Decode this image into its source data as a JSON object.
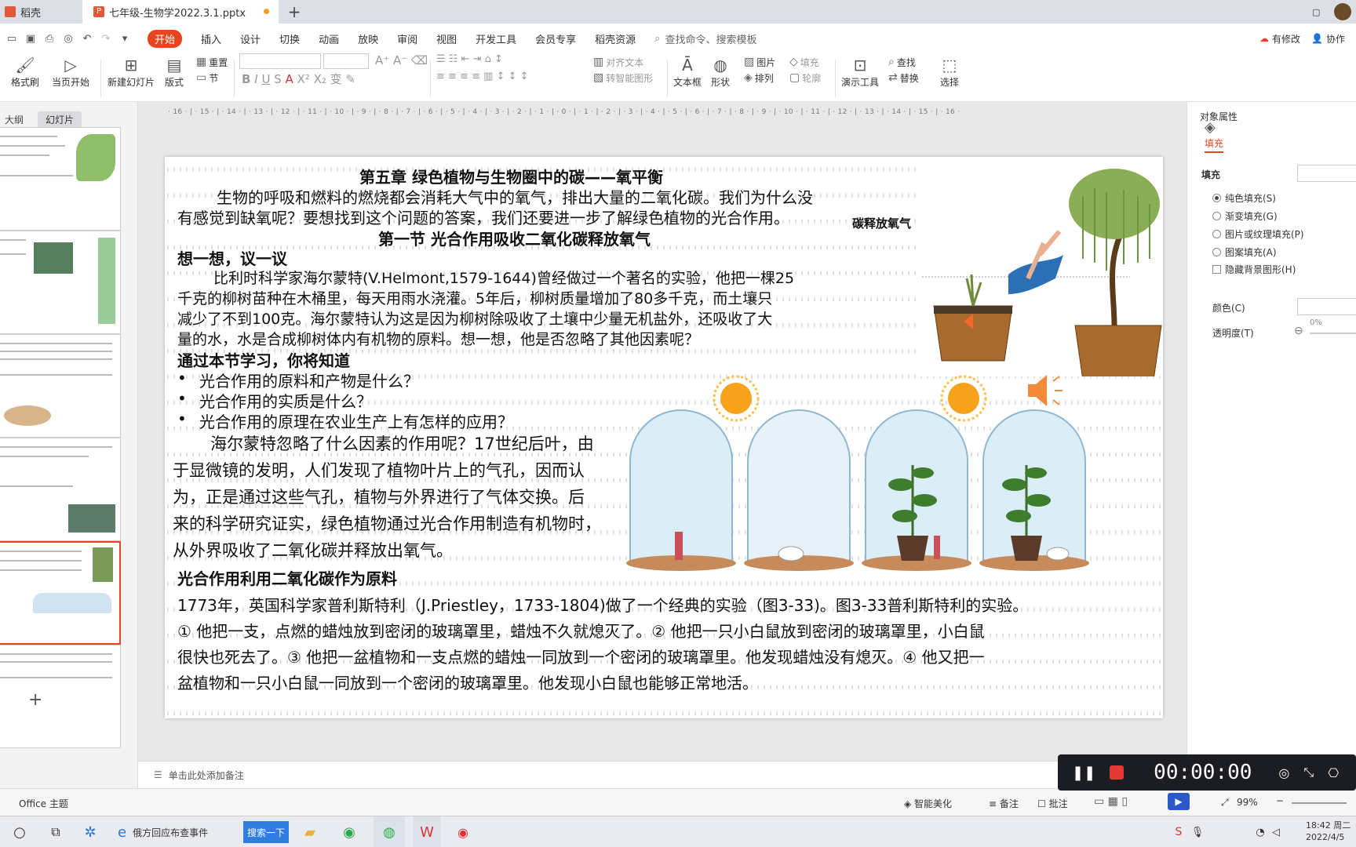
{
  "tabs": [
    {
      "label": "稻壳"
    },
    {
      "label": "七年级-生物学2022.3.1.pptx"
    }
  ],
  "menu": {
    "items": [
      "开始",
      "插入",
      "设计",
      "切换",
      "动画",
      "放映",
      "审阅",
      "视图",
      "开发工具",
      "会员专享",
      "稻壳资源"
    ],
    "search": "查找命令、搜索模板",
    "right": [
      "有修改",
      "协作"
    ]
  },
  "ribbon": {
    "format_painter": "格式刷",
    "from_current": "当页开始",
    "new_slide": "新建幻灯片",
    "layout": "版式",
    "reset": "重置",
    "section": "节",
    "align_text": "对齐文本",
    "smart_shape": "转智能图形",
    "textbox": "文本框",
    "shape": "形状",
    "picture": "图片",
    "fill": "填充",
    "arrange": "排列",
    "outline": "轮廓",
    "present_tools": "演示工具",
    "find": "查找",
    "replace": "替换",
    "select": "选择"
  },
  "left_panel": {
    "outline": "大纲",
    "slides": "幻灯片"
  },
  "slide": {
    "title1": "第五章  绿色植物与生物圈中的碳——氧平衡",
    "intro1": "生物的呼吸和燃料的燃烧都会消耗大气中的氧气，排出大量的二氧化碳。我们为什么没",
    "intro2": "有感觉到缺氧呢？要想找到这个问题的答案，我们还要进一步了解绿色植物的光合作用。",
    "title2": "第一节  光合作用吸收二氧化碳释放氧气",
    "think": "想一想，议一议",
    "p1": "比利时科学家海尔蒙特(V.Helmont,1579-1644)曾经做过一个著名的实验，他把一棵25",
    "p2": "千克的柳树苗种在木桶里，每天用雨水浇灌。5年后，柳树质量增加了80多千克，而土壤只",
    "p3": "减少了不到100克。海尔蒙特认为这是因为柳树除吸收了土壤中少量无机盐外，还吸收了大",
    "p4": "量的水，水是合成柳树体内有机物的原料。想一想，他是否忽略了其他因素呢？",
    "learn": "通过本节学习，你将知道",
    "bullets": [
      "光合作用的原料和产物是什么？",
      "光合作用的实质是什么？",
      "光合作用的原理在农业生产上有怎样的应用？"
    ],
    "q1": "海尔蒙特忽略了什么因素的作用呢？17世纪后叶，由",
    "q2": "于显微镜的发明，人们发现了植物叶片上的气孔，因而认",
    "q3": "为，正是通过这些气孔，植物与外界进行了气体交换。后",
    "q4": "来的科学研究证实，绿色植物通过光合作用制造有机物时，",
    "q5": "从外界吸收了二氧化碳并释放出氧气。",
    "head3": "光合作用利用二氧化碳作为原料",
    "e1": "1773年，英国科学家普利斯特利（J.Priestley，1733-1804)做了一个经典的实验（图3-33)。图3-33普利斯特利的实验。",
    "e2": "① 他把一支，点燃的蜡烛放到密闭的玻璃罩里，蜡烛不久就熄灭了。② 他把一只小白鼠放到密闭的玻璃罩里，小白鼠",
    "e3": "很快也死去了。③ 他把一盆植物和一支点燃的蜡烛一同放到一个密闭的玻璃罩里。他发现蜡烛没有熄灭。④ 他又把一",
    "e4": "盆植物和一只小白鼠一同放到一个密闭的玻璃罩里。他发现小白鼠也能够正常地活。",
    "img_label": "碳释放氧气"
  },
  "right_panel": {
    "header": "对象属性",
    "tab": "填充",
    "section": "填充",
    "options": [
      "纯色填充(S)",
      "渐变填充(G)",
      "图片或纹理填充(P)",
      "图案填充(A)"
    ],
    "hide_bg": "隐藏背景图形(H)",
    "color": "颜色(C)",
    "transparency": "透明度(T)",
    "transparency_value": "0%"
  },
  "notes": "单击此处添加备注",
  "status": {
    "theme": "Office 主题",
    "beautify": "智能美化",
    "notes": "备注",
    "comment": "批注",
    "zoom": "99%"
  },
  "recorder": {
    "time": "00:00:00"
  },
  "taskbar": {
    "app": "俄方回应布查事件",
    "search": "搜索一下",
    "time": "18:42 周二",
    "date": "2022/4/5"
  }
}
